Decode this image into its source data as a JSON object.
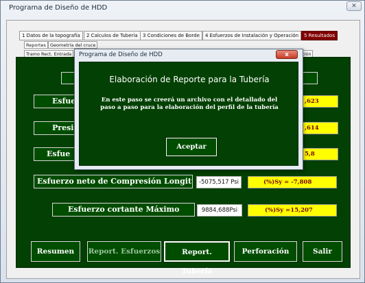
{
  "window": {
    "title": "Programa de Diseño de HDD",
    "close_glyph": "✕"
  },
  "tabs": [
    {
      "label": "1 Datos de la topografía"
    },
    {
      "label": "2 Calculos de Tubería"
    },
    {
      "label": "3 Condiciones de Borde"
    },
    {
      "label": "4 Esfuerzos de Instalación y Operación"
    },
    {
      "label": "5 Resultados"
    }
  ],
  "subtabs": [
    {
      "label": "Reportes"
    },
    {
      "label": "Geometría del cruce"
    }
  ],
  "section_tab": {
    "label": "Tramo Rect. Entrada",
    "right_fragment": "ción"
  },
  "results": [
    {
      "label": "Esfue",
      "percent": ",623"
    },
    {
      "label": "Presi",
      "percent": ",614"
    },
    {
      "label": "Esfue",
      "percent": "5,8"
    },
    {
      "label": "Esfuerzo neto de Compresión  Longitudinal",
      "value": "-5075,517 Psi",
      "percent": "(%)Sy = -7,808"
    },
    {
      "label": "Esfuerzo cortante Máximo",
      "value": "9884,688Psi",
      "percent": "(%)Sy =15,207"
    }
  ],
  "buttons": {
    "resumen": "Resumen",
    "report_esfuerzos": "Report. Esfuerzos",
    "report_tuberia": "Report. Tubería",
    "perforacion": "Perforación",
    "salir": "Salir"
  },
  "dialog": {
    "title": "Programa de Diseño de HDD",
    "close_glyph": "x",
    "heading": "Elaboración de Reporte para la Tubería",
    "message": "En este paso se creerá un archivo con el detallado del paso a paso para la elaboración del perfil de la tubería",
    "ok_label": "Aceptar"
  },
  "colors": {
    "panel_green": "#034003",
    "accent_maroon": "#800000",
    "highlight_yellow": "#ffff00"
  }
}
